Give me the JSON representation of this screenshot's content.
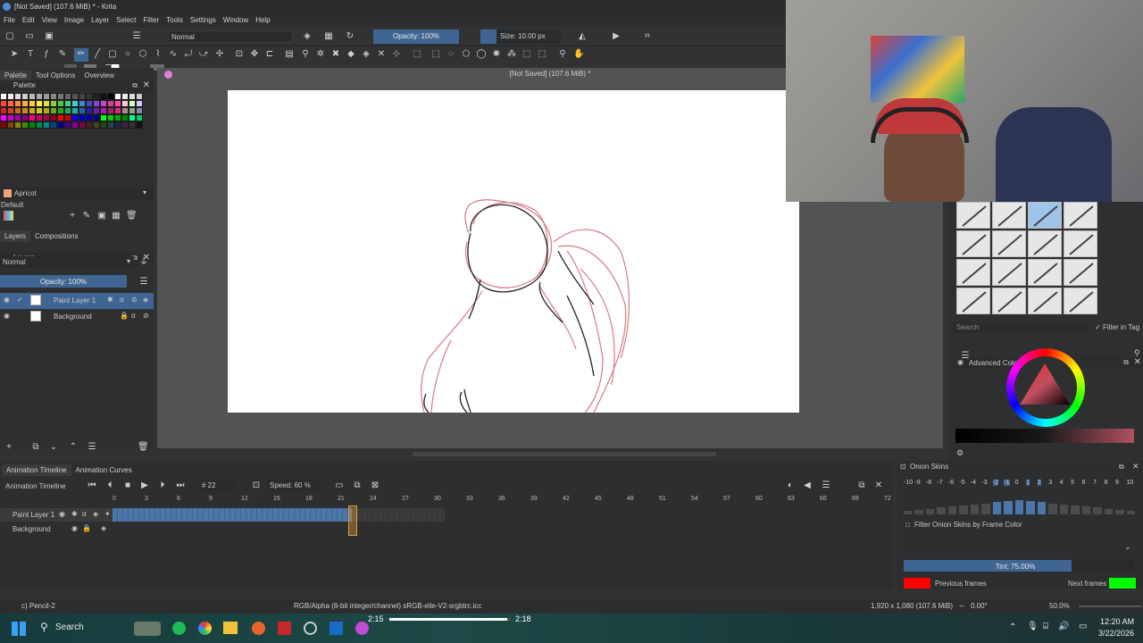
{
  "window": {
    "title": "[Not Saved]  (107.6 MiB) * - Krita",
    "canvas_title": "[Not Saved]  (107.6 MiB) *"
  },
  "menu": [
    "File",
    "Edit",
    "View",
    "Image",
    "Layer",
    "Select",
    "Filter",
    "Tools",
    "Settings",
    "Window",
    "Help"
  ],
  "toolbar": {
    "blend_mode": "Normal",
    "opacity": "Opacity: 100%",
    "size": "Size: 10.00 px"
  },
  "left_dock": {
    "tabs": [
      "Palette",
      "Tool Options",
      "Overview"
    ],
    "palette_title": "Palette",
    "palette_name": "Apricot",
    "palette_default": "Default",
    "layer_tabs": [
      "Layers",
      "Compositions"
    ],
    "layers_title": "Layers",
    "layer_blend": "Normal",
    "layer_opacity": "Opacity: 100%",
    "layers": [
      {
        "name": "Paint Layer 1"
      },
      {
        "name": "Background"
      }
    ]
  },
  "right_dock": {
    "search_placeholder": "Search",
    "filter_in_tag": "Filter in Tag",
    "color_selector_title": "Advanced Color Selector"
  },
  "timeline": {
    "tabs": [
      "Animation Timeline",
      "Animation Curves"
    ],
    "title": "Animation Timeline",
    "frame": "# 22",
    "speed": "Speed: 60 %",
    "ruler": [
      "0",
      "3",
      "6",
      "9",
      "12",
      "15",
      "18",
      "21",
      "24",
      "27",
      "30",
      "33",
      "36",
      "39",
      "42",
      "45",
      "48",
      "51",
      "54",
      "57",
      "60",
      "63",
      "66",
      "69",
      "72"
    ],
    "layers": [
      "Paint Layer 1",
      "Background"
    ]
  },
  "onion": {
    "title": "Onion Skins",
    "numbers": [
      "-10",
      "-9",
      "-8",
      "-7",
      "-6",
      "-5",
      "-4",
      "-3",
      "-2",
      "-1",
      "0",
      "1",
      "2",
      "3",
      "4",
      "5",
      "6",
      "7",
      "8",
      "9",
      "10"
    ],
    "filter_label": "Filter Onion Skins by Frame Color",
    "tint": "Tint: 75.00%",
    "tint_value": 0.75,
    "previous_frames": "Previous frames",
    "next_frames": "Next frames",
    "prev_color": "#ff0000",
    "next_color": "#00ff00"
  },
  "status": {
    "brush": "c) Pencil-2",
    "color_profile": "RGB/Alpha (8-bit integer/channel)  sRGB-elle-V2-srgbtrc.icc",
    "dimensions": "1,920 x 1,080 (107.6 MiB)",
    "rotation": "0.00°",
    "zoom": "50.0%"
  },
  "taskbar": {
    "search": "Search",
    "media_start": "2:15",
    "media_end": "2:18",
    "media_progress": 0.97,
    "time": "12:20 AM",
    "date": "3/22/2026"
  }
}
